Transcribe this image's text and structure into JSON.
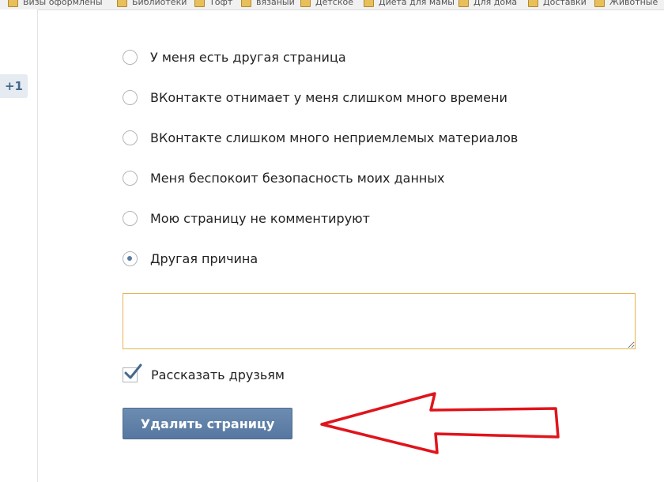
{
  "bookmarks": [
    {
      "label": "Визы оформлены"
    },
    {
      "label": "Библиотеки"
    },
    {
      "label": "Тофт"
    },
    {
      "label": "вязаный"
    },
    {
      "label": "Детское"
    },
    {
      "label": "Диета для мамы"
    },
    {
      "label": "Для дома"
    },
    {
      "label": "Доставки"
    },
    {
      "label": "Животные"
    }
  ],
  "sidebar": {
    "counter": "+1"
  },
  "reasons": [
    {
      "label": "У меня есть другая страница",
      "selected": false
    },
    {
      "label": "ВКонтакте отнимает у меня слишком много времени",
      "selected": false
    },
    {
      "label": "ВКонтакте слишком много неприемлемых материалов",
      "selected": false
    },
    {
      "label": "Меня беспокоит безопасность моих данных",
      "selected": false
    },
    {
      "label": "Мою страницу не комментируют",
      "selected": false
    },
    {
      "label": "Другая причина",
      "selected": true
    }
  ],
  "other_reason_text": {
    "value": ""
  },
  "tell_friends": {
    "label": "Рассказать друзьям",
    "checked": true
  },
  "delete_button": {
    "label": "Удалить страницу"
  },
  "colors": {
    "accent": "#5b7aa0",
    "button": "#6282a9",
    "textarea_border": "#e4b450",
    "annotation_arrow": "#e0141b",
    "sidebar_badge": "#e5ebf1"
  },
  "icons": {
    "radio": "radio-icon",
    "check": "check-icon",
    "folder": "folder-icon",
    "arrow": "red-arrow-annotation"
  }
}
